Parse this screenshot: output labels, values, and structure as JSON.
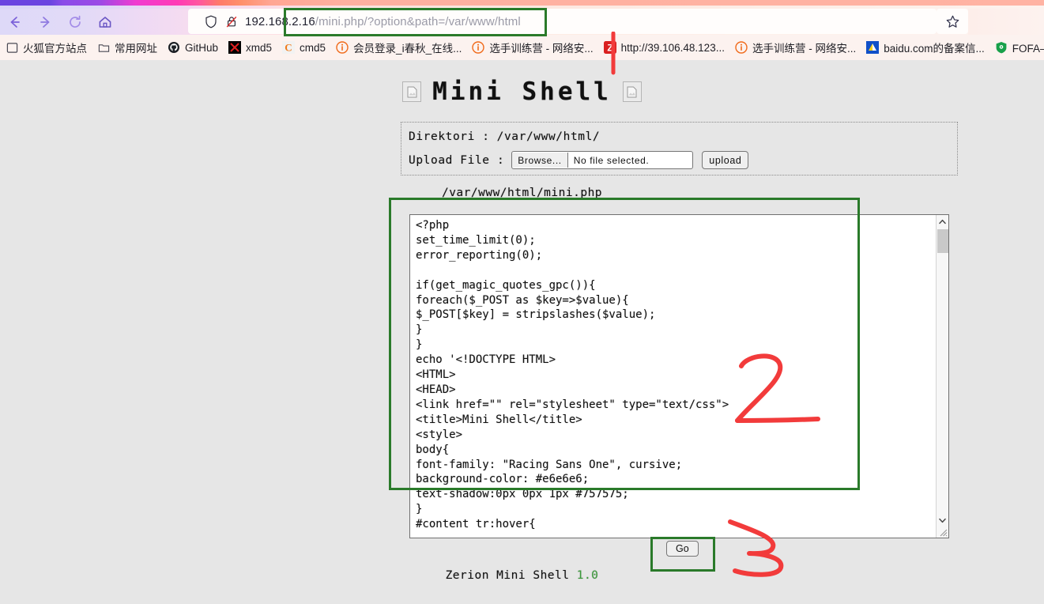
{
  "browser": {
    "nav_buttons": [
      {
        "name": "back",
        "icon": "arrow-left-icon"
      },
      {
        "name": "forward",
        "icon": "arrow-right-icon"
      },
      {
        "name": "reload",
        "icon": "reload-icon"
      },
      {
        "name": "home",
        "icon": "home-icon"
      }
    ],
    "url": {
      "host": "192.168.2.16",
      "path": "/mini.php/?option&path=/var/www/html",
      "full": "192.168.2.16/mini.php/?option&path=/var/www/html"
    },
    "url_icons": [
      "shield-icon",
      "lock-crossed-icon"
    ],
    "star_icon": "star-icon",
    "bookmarks": [
      {
        "label": "火狐官方站点",
        "icon": "firefox-bookmark-icon"
      },
      {
        "label": "常用网址",
        "icon": "folder-icon"
      },
      {
        "label": "GitHub",
        "icon": "github-icon"
      },
      {
        "label": "xmd5",
        "icon": "xmd5-icon"
      },
      {
        "label": "cmd5",
        "icon": "cmd5-icon"
      },
      {
        "label": "会员登录_i春秋_在线...",
        "icon": "ichunqiu-icon"
      },
      {
        "label": "选手训练营 - 网络安...",
        "icon": "ichunqiu-icon"
      },
      {
        "label": "http://39.106.48.123...",
        "icon": "zoomeye-icon"
      },
      {
        "label": "选手训练营 - 网络安...",
        "icon": "ichunqiu-icon"
      },
      {
        "label": "baidu.com的备案信...",
        "icon": "beian-icon"
      },
      {
        "label": "FOFA——强大的网络...",
        "icon": "fofa-icon"
      }
    ]
  },
  "page": {
    "title": "Mini Shell",
    "title_icons": [
      "broken-image-icon",
      "broken-image-icon"
    ],
    "directory": {
      "label": "Direktori :",
      "value": "/var/www/html/"
    },
    "upload": {
      "label": "Upload File :",
      "browse_button": "Browse...",
      "file_status": "No file selected.",
      "upload_button": "upload"
    },
    "file_path": "/var/www/html/mini.php",
    "editor": {
      "content": "<?php\nset_time_limit(0);\nerror_reporting(0);\n\nif(get_magic_quotes_gpc()){\nforeach($_POST as $key=>$value){\n$_POST[$key] = stripslashes($value);\n}\n}\necho '<!DOCTYPE HTML>\n<HTML>\n<HEAD>\n<link href=\"\" rel=\"stylesheet\" type=\"text/css\">\n<title>Mini Shell</title>\n<style>\nbody{\nfont-family: \"Racing Sans One\", cursive;\nbackground-color: #e6e6e6;\ntext-shadow:0px 0px 1px #757575;\n}\n#content tr:hover{",
      "scrollbar_up_icon": "chevron-up-icon",
      "scrollbar_down_icon": "chevron-down-icon",
      "resize_grip_icon": "resize-grip-icon"
    },
    "go_button": "Go",
    "footer": {
      "text": "Zerion Mini Shell ",
      "version": "1.0",
      "version_color": "#3a9b3a"
    }
  },
  "annotations": {
    "marker_color": "#f23b3b",
    "box_color": "#2a7a2a",
    "markers": [
      {
        "name": "marker-1",
        "shape": "vertical-line"
      },
      {
        "name": "marker-2",
        "shape": "digit-2"
      },
      {
        "name": "marker-3",
        "shape": "digit-3"
      }
    ],
    "boxes": [
      {
        "name": "url-highlight-box"
      },
      {
        "name": "code-highlight-box"
      },
      {
        "name": "go-highlight-box"
      }
    ]
  }
}
